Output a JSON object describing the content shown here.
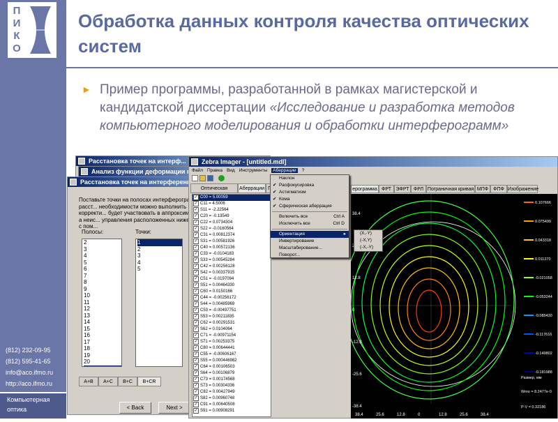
{
  "logo": {
    "letters": [
      "П",
      "И",
      "К",
      "О"
    ]
  },
  "slide": {
    "title": "Обработка данных контроля качества оптических систем",
    "bullet_plain": "Пример программы, разработанной в рамках магистерской и кандидатской диссертации ",
    "bullet_italic": "«Исследование и разработка методов компьютерного моделирования и обработки интерферограмм»"
  },
  "contacts": {
    "phone1": "(812) 232-09-95",
    "phone2": "(812) 595-41-65",
    "email": "info@aco.ifmo.ru",
    "url": "http://aco.ifmo.ru"
  },
  "footer": {
    "line1": "Компьютерная",
    "line2": "оптика"
  },
  "win_back2": {
    "title": "Расстановка точек на интерф..."
  },
  "win_back1": {
    "title": "Анализ функции деформации вол..."
  },
  "win_front": {
    "title": "Расстановка точек на интерференционной ...",
    "instructions": "Поставьте точки на полосах интерферограммы расст... необходимости можно выполнить корректи... будет участвовать в аппроксимации, а неис... управления расположенных ниже или с пом...",
    "lbl_bands": "Полосы:",
    "lbl_points": "Точки:",
    "bands": [
      "2",
      "3",
      "4",
      "5",
      "6",
      "7",
      "8",
      "9",
      "10",
      "11",
      "12",
      "13",
      "14",
      "15",
      "16",
      "17",
      "18",
      "19",
      "20",
      "21"
    ],
    "points": [
      "1",
      "2",
      "3",
      "4",
      "5"
    ],
    "tabs": [
      "A+B",
      "A+C",
      "B+C",
      "B+CR"
    ],
    "back_button": "< Back",
    "next_button": "Next >"
  },
  "zebra": {
    "title": "Zebra Imager - [untitled.mdl]",
    "menu": [
      "Файл",
      "Правка",
      "Вид",
      "Инструменты",
      "Аберрации",
      "?"
    ],
    "left_tabs": [
      "Оптическая система",
      "Аберрации",
      "Г"
    ],
    "coeffs": [
      "C00 = 5.00059",
      "C11 = 4.5006",
      "S11 = -2.22564",
      "C20 = -0.13549",
      "C22 = 0.0734304",
      "S22 = -0.0160564",
      "C31 = 0.00812374",
      "S31 = 0.00581926",
      "C40 = 0.00572136",
      "C33 = -0.0104183",
      "S33 = 0.00545284",
      "C42 = 0.00256128",
      "S42 = 0.00337915",
      "C51 = -0.0197094",
      "S51 = 0.00464330",
      "C60 = 0.0150166",
      "C44 = -0.00256172",
      "S44 = 0.00485969",
      "C53 = -0.00497751",
      "S53 = 0.00211835",
      "C62 = 0.00291531",
      "S62 = 0.0104064",
      "C71 = -0.00971154",
      "S71 = 0.00253375",
      "C80 = 0.00644441",
      "C55 = -0.00606167",
      "S55 = 0.000446982",
      "C64 = 0.00106503",
      "S64 = 0.00106879",
      "C73 = 0.00174568",
      "S73 = 0.00304336",
      "C82 = 0.00427949",
      "S82 = 0.00960748",
      "C91 = 0.00640508",
      "S91 = 0.00908291"
    ],
    "aberr_menu": [
      "Наклон",
      "Расфокусировка",
      "Астигматизм",
      "Кома",
      "Сферическая аберрация"
    ],
    "aberr_checked": [
      false,
      true,
      true,
      true,
      true
    ],
    "menu2": [
      [
        "Включить все",
        "Ctrl A"
      ],
      [
        "Исключить все",
        "Ctrl D"
      ]
    ],
    "menu3": [
      "Ориентация",
      "Инвертирование",
      "Масштабирование...",
      "Поворот..."
    ],
    "submenu": [
      "(X,-Y)",
      "(-X,Y)",
      "(-X,-Y)"
    ],
    "right_tabs": [
      "ерограмма",
      "ФРТ",
      "ЭФРТ",
      "ФРЛ",
      "Пограничная кривая",
      "МПФ",
      "ФПФ",
      "Изображение"
    ],
    "axis_y": [
      "38.4",
      "25.6",
      "12.8",
      "0",
      "-12.8",
      "-25.6",
      "-38.4"
    ],
    "axis_x": [
      "38.4",
      "25.6",
      "12.8",
      "0",
      "12.8",
      "25.6",
      "38.4"
    ],
    "legend_values": [
      "0.107666",
      "0.075499",
      "0.043318",
      "0.011270",
      "-0.021058",
      "-0.053244",
      "-0.085430",
      "-0.117616",
      "-0.149802",
      "-0.181988"
    ],
    "legend_colors": [
      "#ff6a00",
      "#ffa000",
      "#ffc800",
      "#ffff00",
      "#a0ff00",
      "#00ff00",
      "#00a0ff",
      "#0050ff",
      "#0000c0",
      "#000080"
    ],
    "readout1": "Размер, мм",
    "readout2": "Wmo = 8.2477e-0",
    "readout3": "P-V = 0.32186"
  }
}
